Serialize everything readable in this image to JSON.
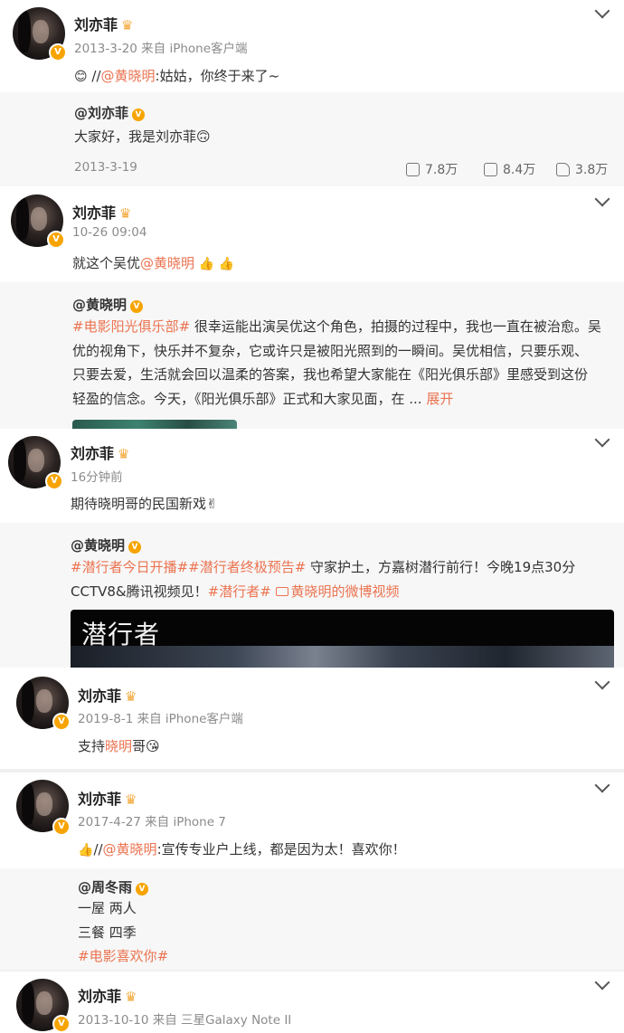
{
  "posts": [
    {
      "author": "刘亦菲",
      "meta": "2013-3-20 来自 iPhone客户端",
      "emoji_lead": "😊",
      "prefix": "//",
      "mention": "@黄晓明",
      "text": ":姑姑，你终于来了~",
      "repost": {
        "author": "@刘亦菲",
        "text": "大家好，我是刘亦菲🙃",
        "date": "2013-3-19",
        "reposts": "7.8万",
        "comments": "8.4万",
        "likes": "3.8万"
      }
    },
    {
      "author": "刘亦菲",
      "meta": "10-26 09:04",
      "text": "就这个吴优",
      "mention": "@黄晓明",
      "emoji_tail": "👍 👍",
      "repost": {
        "author": "@黄晓明",
        "tag": "#电影阳光俱乐部#",
        "line1": " 很幸运能出演吴优这个角色，拍摄的过程中，我也一直在被治愈。吴",
        "line2": "优的视角下，快乐并不复杂，它或许只是被阳光照到的一瞬间。吴优相信，只要乐观、",
        "line3": "只要去爱，生活就会回以温柔的答案，我也希望大家能在《阳光俱乐部》里感受到这份",
        "line4": "轻盈的信念。今天，《阳光俱乐部》正式和大家见面，在 ... ",
        "expand": "展开"
      }
    },
    {
      "author": "刘亦菲",
      "meta": "16分钟前",
      "text": "期待晓明哥的民国新戏✌",
      "repost": {
        "author": "@黄晓明",
        "tags": "#潜行者今日开播##潜行者终极预告#",
        "line1_rest": " 守家护土，方嘉树潜行前行！今晚19点30分",
        "line2_a": "CCTV8&腾讯视频见！",
        "line2_tag": "#潜行者#",
        "line2_video": "黄晓明的微博视频",
        "video_title": "潜行者"
      }
    },
    {
      "author": "刘亦菲",
      "meta": "2019-8-1 来自 iPhone客户端",
      "text_a": "支持",
      "text_hl": "晓明",
      "text_b": "哥😘"
    },
    {
      "author": "刘亦菲",
      "meta": "2017-4-27 来自 iPhone 7",
      "emoji_lead": "👍",
      "prefix": "//",
      "mention": "@黄晓明",
      "text": ":宣传专业户上线，都是因为太！喜欢你！",
      "repost": {
        "author": "@周冬雨",
        "line1": "一屋 两人",
        "line2": "三餐 四季",
        "tag": "#电影喜欢你#"
      }
    },
    {
      "author": "刘亦菲",
      "meta": "2013-10-10 来自 三星Galaxy Note II"
    }
  ],
  "colors": {
    "accent": "#eb7350",
    "badge": "#f7a400",
    "repost_bg": "#f7f7f7"
  },
  "icons": [
    "chevron-down-icon",
    "verified-icon",
    "crown-icon",
    "repost-icon",
    "comment-icon",
    "like-icon"
  ]
}
